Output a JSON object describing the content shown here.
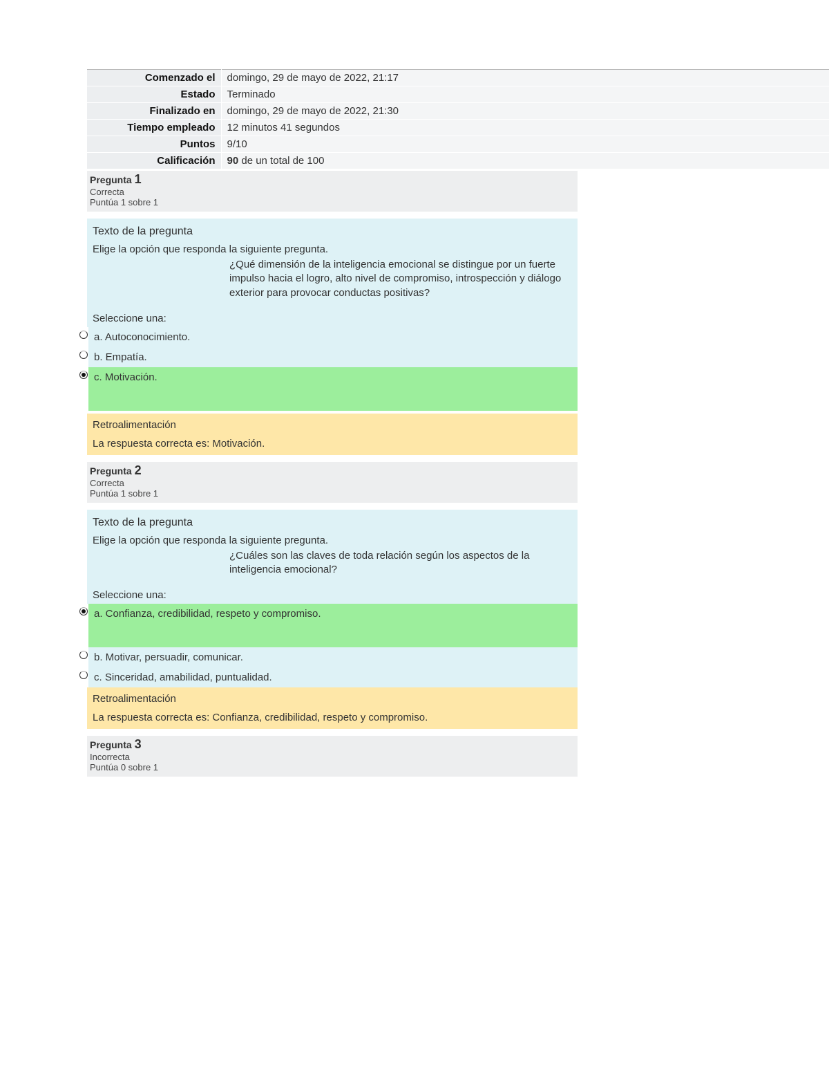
{
  "summary": {
    "rows": [
      {
        "label": "Comenzado el",
        "value": "domingo, 29 de mayo de 2022, 21:17"
      },
      {
        "label": "Estado",
        "value": "Terminado"
      },
      {
        "label": "Finalizado en",
        "value": "domingo, 29 de mayo de 2022, 21:30"
      },
      {
        "label": "Tiempo empleado",
        "value": "12 minutos 41 segundos"
      },
      {
        "label": "Puntos",
        "value": "9/10"
      },
      {
        "label": "Calificación",
        "value_bold": "90",
        "value_rest": " de un total de 100"
      }
    ]
  },
  "labels": {
    "pregunta": "Pregunta",
    "texto_pregunta": "Texto de la pregunta",
    "seleccione": "Seleccione una:",
    "retro": "Retroalimentación"
  },
  "questions": [
    {
      "num": "1",
      "status": "Correcta",
      "marks": "Puntúa 1 sobre 1",
      "prompt": "Elige la opción que responda la siguiente pregunta.",
      "text": "¿Qué dimensión de la inteligencia emocional se distingue por un fuerte impulso hacia el logro, alto nivel de compromiso, introspección y diálogo exterior para provocar conductas positivas?",
      "options": [
        {
          "label": "a. Autoconocimiento.",
          "selected": false,
          "correct": false
        },
        {
          "label": "b. Empatía.",
          "selected": false,
          "correct": false
        },
        {
          "label": "c. Motivación.",
          "selected": true,
          "correct": true
        }
      ],
      "feedback": "La respuesta correcta es: Motivación."
    },
    {
      "num": "2",
      "status": "Correcta",
      "marks": "Puntúa 1 sobre 1",
      "prompt": "Elige la opción que responda la siguiente pregunta.",
      "text": "¿Cuáles son las claves de toda relación según los aspectos de la inteligencia emocional?",
      "options": [
        {
          "label": "a. Confianza, credibilidad, respeto y compromiso.",
          "selected": true,
          "correct": true
        },
        {
          "label": "b. Motivar, persuadir, comunicar.",
          "selected": false,
          "correct": false
        },
        {
          "label": "c. Sinceridad, amabilidad, puntualidad.",
          "selected": false,
          "correct": false
        }
      ],
      "feedback": "La respuesta correcta es: Confianza, credibilidad, respeto y compromiso."
    },
    {
      "num": "3",
      "status": "Incorrecta",
      "marks": "Puntúa 0 sobre 1"
    }
  ]
}
